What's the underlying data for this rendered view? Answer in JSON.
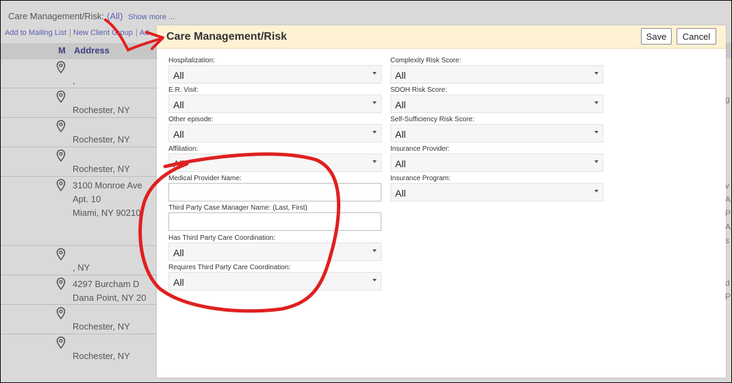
{
  "background": {
    "filter_label": "Care Management/Risk:",
    "filter_value": "(All)",
    "show_more": "Show more ...",
    "actions": [
      "Add to Mailing List",
      "New Client Group",
      "Ad"
    ],
    "columns": {
      "m": "M",
      "address": "Address"
    },
    "rows": [
      {
        "line1": ",",
        "line2": "",
        "line3": ""
      },
      {
        "line1": "Rochester, NY",
        "line2": "",
        "line3": ""
      },
      {
        "line1": "Rochester, NY",
        "line2": "",
        "line3": ""
      },
      {
        "line1": "Rochester, NY",
        "line2": "",
        "line3": ""
      },
      {
        "line1": "3100 Monroe Ave",
        "line2": "Apt. 10",
        "line3": "Miami, NY 90210"
      },
      {
        "line1": ", NY",
        "line2": "",
        "line3": ""
      },
      {
        "line1": "4297 Burcham D",
        "line2": "Dana Point, NY 20",
        "line3": ""
      },
      {
        "line1": "Rochester, NY",
        "line2": "",
        "line3": ""
      },
      {
        "line1": "Rochester, NY",
        "line2": "",
        "line3": ""
      }
    ],
    "right_fragments": [
      "g",
      "v",
      "A",
      "P",
      "A",
      "s",
      "d",
      "P"
    ]
  },
  "dialog": {
    "title": "Care Management/Risk",
    "save_label": "Save",
    "cancel_label": "Cancel",
    "left_fields": [
      {
        "label": "Hospitalization:",
        "type": "select",
        "value": "All"
      },
      {
        "label": "E.R. Visit:",
        "type": "select",
        "value": "All"
      },
      {
        "label": "Other episode:",
        "type": "select",
        "value": "All"
      },
      {
        "label": "Affiliation:",
        "type": "select",
        "value": "All"
      },
      {
        "label": "Medical Provider Name:",
        "type": "input",
        "value": ""
      },
      {
        "label": "Third Party Case Manager Name: (Last, First)",
        "type": "input",
        "value": ""
      },
      {
        "label": "Has Third Party Care Coordination:",
        "type": "select",
        "value": "All"
      },
      {
        "label": "Requires Third Party Care Coordination:",
        "type": "select",
        "value": "All"
      }
    ],
    "right_fields": [
      {
        "label": "Complexity Risk Score:",
        "type": "select",
        "value": "All"
      },
      {
        "label": "SDOH Risk Score:",
        "type": "select",
        "value": "All"
      },
      {
        "label": "Self-Sufficiency Risk Score:",
        "type": "select",
        "value": "All"
      },
      {
        "label": "Insurance Provider:",
        "type": "select",
        "value": "All"
      },
      {
        "label": "Insurance Program:",
        "type": "select",
        "value": "All"
      }
    ]
  },
  "annotation": {
    "color": "#e02020"
  }
}
